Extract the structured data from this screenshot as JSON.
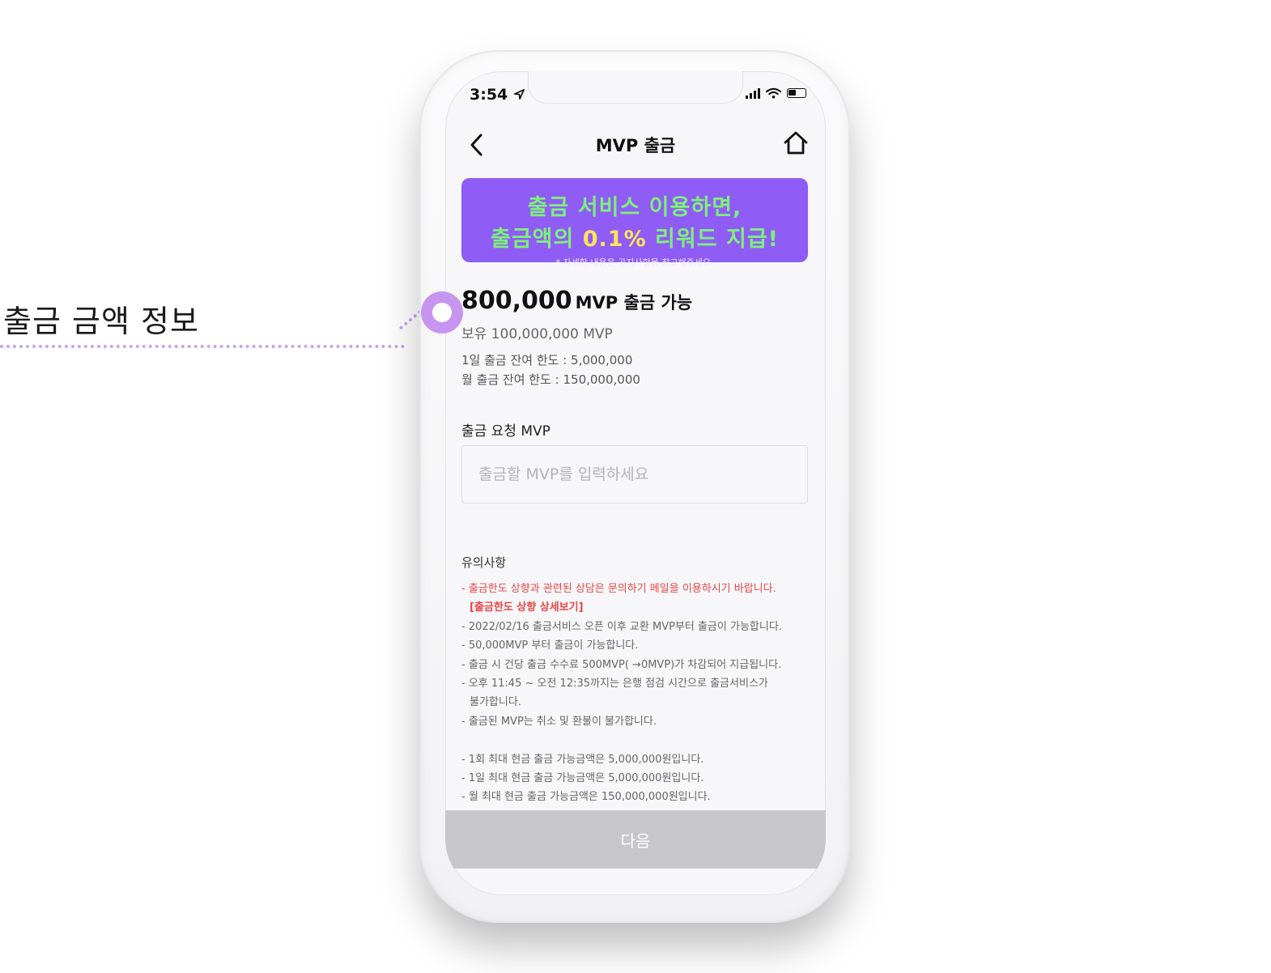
{
  "callout": {
    "label": "출금 금액 정보"
  },
  "status_bar": {
    "time": "3:54"
  },
  "header": {
    "title": "MVP 출금"
  },
  "banner": {
    "line1": "출금 서비스 이용하면,",
    "line2_prefix": "출금액의 ",
    "line2_accent": "0.1%",
    "line2_suffix": " 리워드 지급!",
    "note": "* 자세한 내용은 공지사항을 참고해주세요."
  },
  "withdraw_info": {
    "available_amount": "800,000",
    "available_suffix": "MVP 출금 가능",
    "holding": "보유 100,000,000 MVP",
    "daily_limit": "1일 출금 잔여 한도 : 5,000,000",
    "monthly_limit": "월 출금 잔여 한도 : 150,000,000"
  },
  "request": {
    "label": "출금 요청 MVP",
    "value": "",
    "placeholder": "출금할 MVP를 입력하세요"
  },
  "notice": {
    "title": "유의사항",
    "red_line": "- 출금한도 상향과 관련된 상담은 문의하기 메일을 이용하시기 바랍니다.",
    "link": "[출금한도 상향 상세보기]",
    "lines": [
      "- 2022/02/16 출금서비스 오픈 이후 교환 MVP부터 출금이 가능합니다.",
      "- 50,000MVP 부터 출금이 가능합니다.",
      "- 출금 시 건당 출금 수수료 500MVP( →0MVP)가 차감되어 지급됩니다.",
      "- 오후 11:45 ~ 오전 12:35까지는 은행 점검 시간으로 출금서비스가",
      "불가합니다.",
      "- 출금된 MVP는 취소 및 환불이 불가합니다."
    ],
    "cash_lines": [
      "- 1회 최대 현금 출금 가능금액은 5,000,000원입니다.",
      "- 1일 최대 현금 출금 가능금액은 5,000,000원입니다.",
      "- 월 최대 현금 출금 가능금액은 150,000,000원입니다."
    ]
  },
  "footer": {
    "next_label": "다음"
  },
  "colors": {
    "banner_bg": "#8f5cf5",
    "banner_text": "#7ef07a",
    "banner_accent": "#ffe45a",
    "notice_red": "#e84545",
    "callout": "#c794f0",
    "button_disabled": "#c7c7ca"
  }
}
